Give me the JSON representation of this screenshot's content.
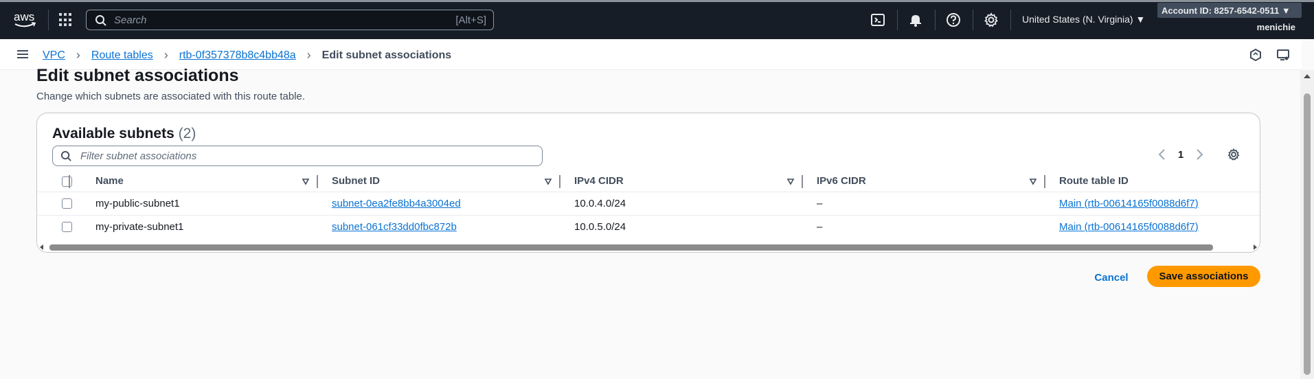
{
  "topnav": {
    "logo_text": "aws",
    "search_placeholder": "Search",
    "search_shortcut": "[Alt+S]",
    "region": "United States (N. Virginia) ▼",
    "account": "Account ID: 8257-6542-0511 ▼",
    "username": "menichie"
  },
  "breadcrumb": {
    "items": [
      "VPC",
      "Route tables",
      "rtb-0f357378b8c4bb48a"
    ],
    "current": "Edit subnet associations"
  },
  "header": {
    "title": "Edit subnet associations",
    "description": "Change which subnets are associated with this route table."
  },
  "table": {
    "title": "Available subnets",
    "count": "(2)",
    "filter_placeholder": "Filter subnet associations",
    "page": "1",
    "columns": [
      "Name",
      "Subnet ID",
      "IPv4 CIDR",
      "IPv6 CIDR",
      "Route table ID"
    ],
    "rows": [
      {
        "name": "my-public-subnet1",
        "subnet_id": "subnet-0ea2fe8bb4a3004ed",
        "ipv4": "10.0.4.0/24",
        "ipv6": "–",
        "route_table": "Main (rtb-00614165f0088d6f7)"
      },
      {
        "name": "my-private-subnet1",
        "subnet_id": "subnet-061cf33dd0fbc872b",
        "ipv4": "10.0.5.0/24",
        "ipv6": "–",
        "route_table": "Main (rtb-00614165f0088d6f7)"
      }
    ]
  },
  "actions": {
    "cancel": "Cancel",
    "save": "Save associations"
  },
  "colors": {
    "nav_bg": "#161d26",
    "link": "#0972d3",
    "primary_button": "#ff9900"
  }
}
